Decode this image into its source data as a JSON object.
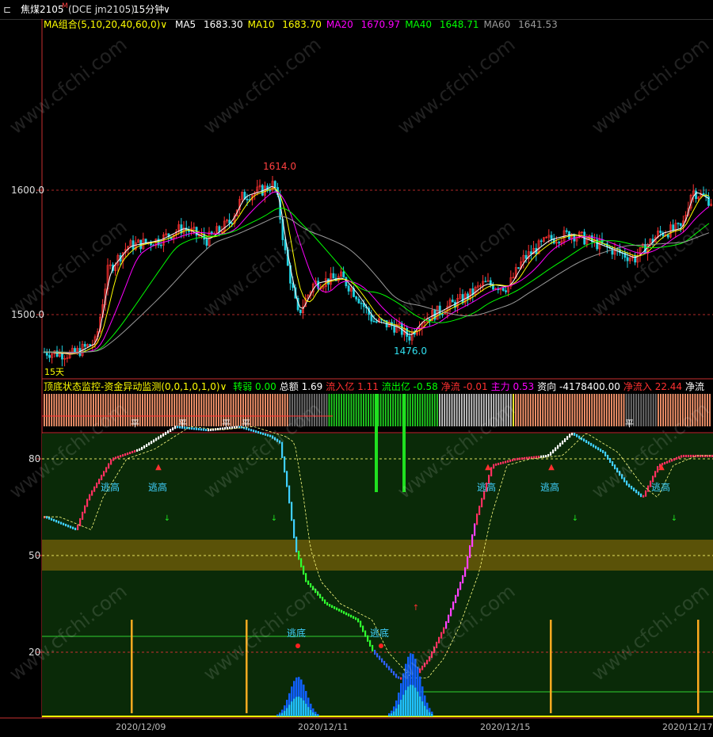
{
  "title_bar": {
    "window_icon": "window-icon",
    "symbol": "焦煤2105",
    "symbol_mark": "M",
    "exchange_code": "(DCE jm2105)",
    "period": "15分钟",
    "period_chevron": "chevron-down-icon"
  },
  "ma_bar": {
    "group_label": "MA组合(5,10,20,40,60,0)",
    "chevron": "chevron-down-icon",
    "items": [
      {
        "label": "MA5",
        "value": "1683.30",
        "color": "#ffffff"
      },
      {
        "label": "MA10",
        "value": "1683.70",
        "color": "#ffff00"
      },
      {
        "label": "MA20",
        "value": "1670.97",
        "color": "#ff00ff"
      },
      {
        "label": "MA40",
        "value": "1648.71",
        "color": "#00ff00"
      },
      {
        "label": "MA60",
        "value": "1641.53",
        "color": "#9a9a9a"
      }
    ]
  },
  "price_chart": {
    "y_ticks": [
      "1600.0",
      "1500.0"
    ],
    "high_label": "1614.0",
    "low_label": "1476.0",
    "left_note": "15天"
  },
  "indicator_bar": {
    "name": "顶底状态监控-资金异动监测(0,0,1,0,1,0)",
    "chevron": "chevron-down-icon",
    "items": [
      {
        "label": "转弱",
        "value": "0.00",
        "label_color": "#00ff00",
        "value_color": "#00ff00"
      },
      {
        "label": "总额",
        "value": "1.69",
        "label_color": "#ffffff",
        "value_color": "#ffffff"
      },
      {
        "label": "流入亿",
        "value": "1.11",
        "label_color": "#ff3030",
        "value_color": "#ff3030"
      },
      {
        "label": "流出亿",
        "value": "-0.58",
        "label_color": "#00ff00",
        "value_color": "#00ff00"
      },
      {
        "label": "净流",
        "value": "-0.01",
        "label_color": "#ff3030",
        "value_color": "#ff3030"
      },
      {
        "label": "主力",
        "value": "0.53",
        "label_color": "#ff00ff",
        "value_color": "#ff00ff"
      },
      {
        "label": "资向",
        "value": "-4178400.00",
        "label_color": "#ffffff",
        "value_color": "#ffffff"
      },
      {
        "label": "净流入",
        "value": "22.44",
        "label_color": "#ff3030",
        "value_color": "#ff3030"
      },
      {
        "label": "净流",
        "value": "",
        "label_color": "#ffffff",
        "value_color": "#ffffff"
      }
    ]
  },
  "state_strip": {
    "marks": [
      "平",
      "平",
      "平",
      "平",
      "平"
    ]
  },
  "indicator_chart": {
    "y_ticks": [
      "80",
      "50",
      "20"
    ],
    "escape_high": [
      "逃高",
      "逃高",
      "逃高",
      "逃高",
      "逃高"
    ],
    "escape_low": [
      "逃底",
      "逃底"
    ]
  },
  "dates": [
    "2020/12/09",
    "2020/12/11",
    "2020/12/15",
    "2020/12/17"
  ],
  "watermark": "www.cfchi.com",
  "colors": {
    "grid_red": "#c83030",
    "up": "#ff3030",
    "down": "#20d0e0",
    "orange_bar": "#ff9a70"
  }
}
